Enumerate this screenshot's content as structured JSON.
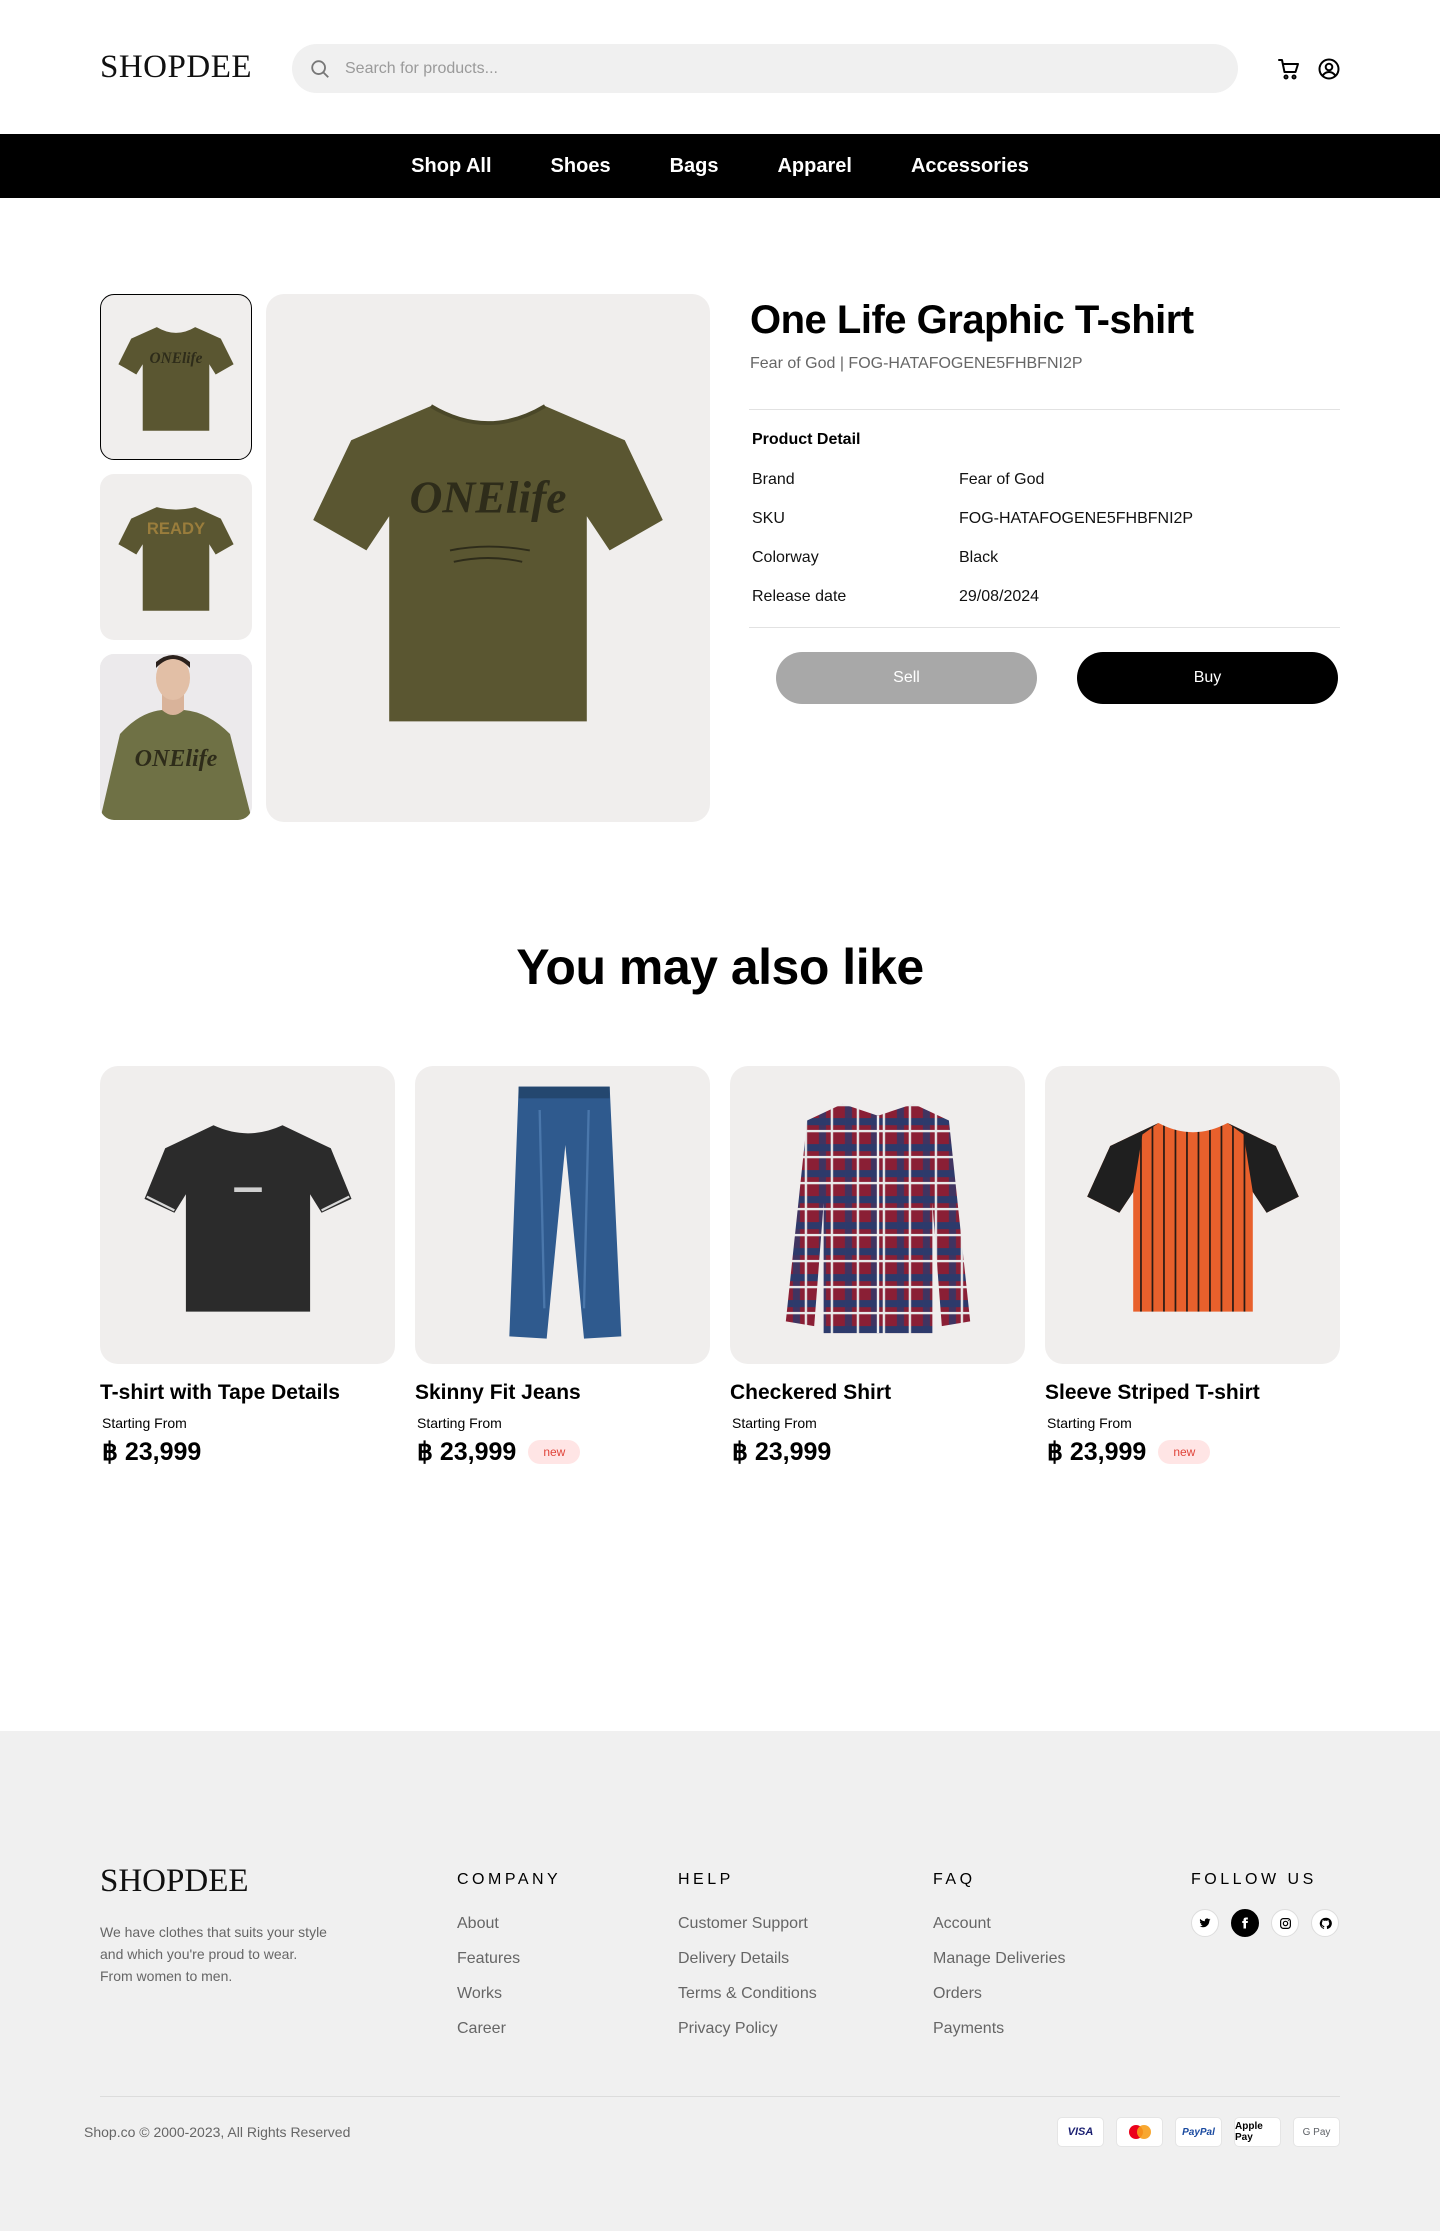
{
  "header": {
    "logo": "SHOPDEE",
    "search_placeholder": "Search for products..."
  },
  "nav": [
    "Shop All",
    "Shoes",
    "Bags",
    "Apparel",
    "Accessories"
  ],
  "product": {
    "title": "One Life Graphic T-shirt",
    "subtitle": "Fear of God | FOG-HATAFOGENE5FHBFNI2P",
    "detail_heading": "Product Detail",
    "details": [
      {
        "label": "Brand",
        "value": "Fear of God"
      },
      {
        "label": "SKU",
        "value": "FOG-HATAFOGENE5FHBFNI2P"
      },
      {
        "label": "Colorway",
        "value": "Black"
      },
      {
        "label": "Release date",
        "value": "29/08/2024"
      }
    ],
    "sell_label": "Sell",
    "buy_label": "Buy",
    "shirt_color": "#5a5631",
    "print_front": "ONElife",
    "print_back": "READY"
  },
  "related": {
    "title": "You may also like",
    "items": [
      {
        "name": "T-shirt with Tape Details",
        "from": "Starting From",
        "price": "฿ 23,999",
        "badge": ""
      },
      {
        "name": "Skinny Fit Jeans",
        "from": "Starting From",
        "price": "฿ 23,999",
        "badge": "new"
      },
      {
        "name": "Checkered Shirt",
        "from": "Starting From",
        "price": "฿ 23,999",
        "badge": ""
      },
      {
        "name": "Sleeve Striped T-shirt",
        "from": "Starting From",
        "price": "฿ 23,999",
        "badge": "new"
      }
    ]
  },
  "footer": {
    "logo": "SHOPDEE",
    "desc_lines": [
      "We have clothes that suits your style",
      "and which you're proud to wear.",
      "From women to men."
    ],
    "columns": [
      {
        "title": "COMPANY",
        "links": [
          "About",
          "Features",
          "Works",
          "Career"
        ]
      },
      {
        "title": "HELP",
        "links": [
          "Customer Support",
          "Delivery Details",
          "Terms & Conditions",
          "Privacy Policy"
        ]
      },
      {
        "title": "FAQ",
        "links": [
          "Account",
          "Manage Deliveries",
          "Orders",
          "Payments"
        ]
      }
    ],
    "follow_title": "FOLLOW US",
    "socials": [
      "twitter-icon",
      "facebook-icon",
      "instagram-icon",
      "github-icon"
    ],
    "copyright": "Shop.co © 2000-2023, All Rights Reserved",
    "payments": [
      "VISA",
      "mastercard",
      "PayPal",
      "Apple Pay",
      "G Pay"
    ]
  }
}
